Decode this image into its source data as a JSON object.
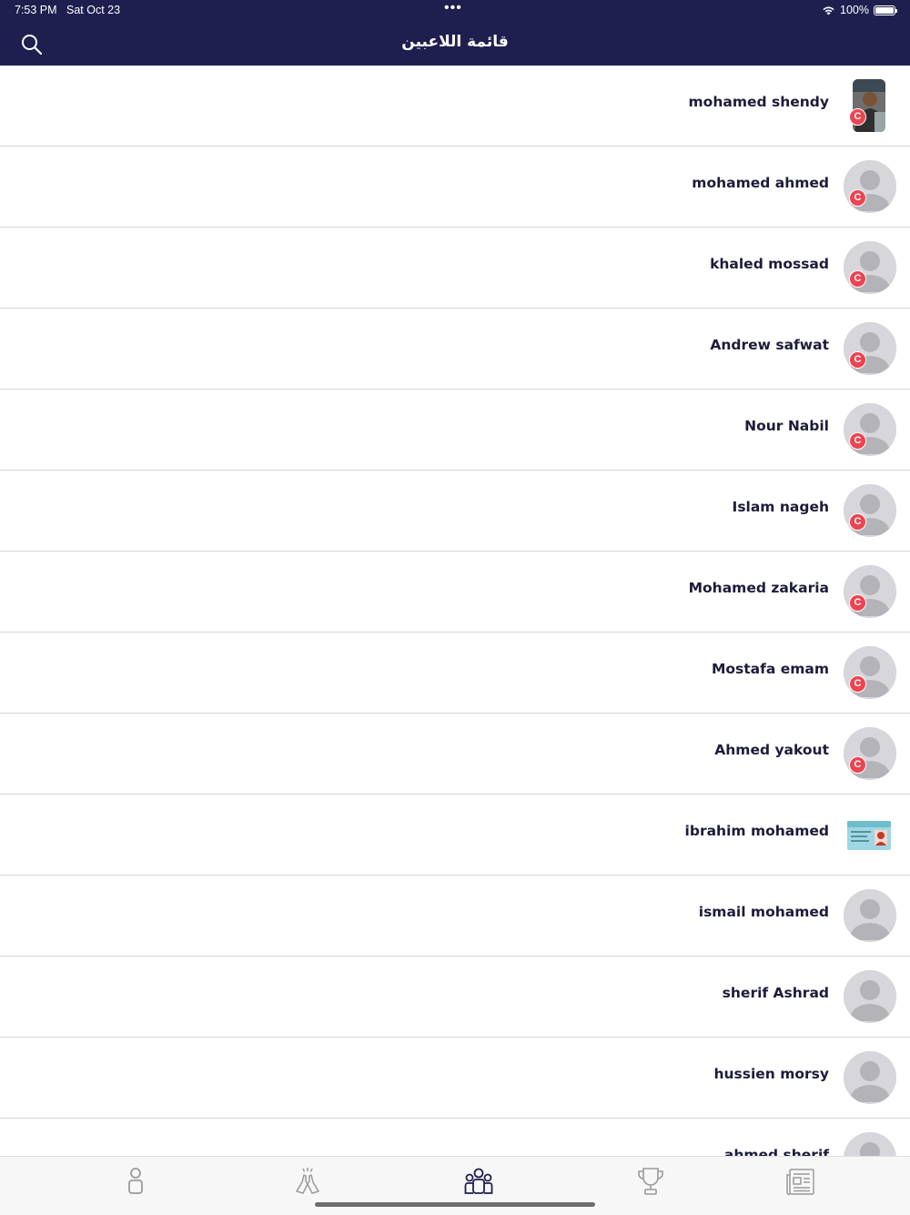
{
  "status_bar": {
    "time": "7:53 PM",
    "date": "Sat Oct 23",
    "dots": "•••",
    "battery": "100%",
    "battery_level": 1.0
  },
  "header": {
    "title": "قائمة اللاعبين",
    "search_icon": "search-icon"
  },
  "players": [
    {
      "name": "mohamed shendy",
      "avatar": "photo",
      "badge": "C"
    },
    {
      "name": "mohamed ahmed",
      "avatar": "placeholder",
      "badge": "C"
    },
    {
      "name": "khaled mossad",
      "avatar": "placeholder",
      "badge": "C"
    },
    {
      "name": "Andrew safwat",
      "avatar": "placeholder",
      "badge": "C"
    },
    {
      "name": "Nour Nabil",
      "avatar": "placeholder",
      "badge": "C"
    },
    {
      "name": "Islam nageh",
      "avatar": "placeholder",
      "badge": "C"
    },
    {
      "name": "Mohamed zakaria",
      "avatar": "placeholder",
      "badge": "C"
    },
    {
      "name": "Mostafa emam",
      "avatar": "placeholder",
      "badge": "C"
    },
    {
      "name": "Ahmed yakout",
      "avatar": "placeholder",
      "badge": "C"
    },
    {
      "name": "ibrahim mohamed",
      "avatar": "id-card",
      "badge": ""
    },
    {
      "name": "ismail mohamed",
      "avatar": "placeholder",
      "badge": ""
    },
    {
      "name": "sherif Ashrad",
      "avatar": "placeholder",
      "badge": ""
    },
    {
      "name": "hussien morsy",
      "avatar": "placeholder",
      "badge": ""
    },
    {
      "name": "ahmed sherif",
      "avatar": "placeholder",
      "badge": ""
    }
  ],
  "tabs": [
    {
      "icon": "person-icon",
      "active": false
    },
    {
      "icon": "high-five-icon",
      "active": false
    },
    {
      "icon": "team-icon",
      "active": true
    },
    {
      "icon": "trophy-icon",
      "active": false
    },
    {
      "icon": "news-icon",
      "active": false
    }
  ],
  "colors": {
    "header_bg": "#1f1f4f",
    "badge": "#ec4450",
    "active_tab": "#1f1f4f",
    "inactive_tab": "#9a9a9a"
  }
}
